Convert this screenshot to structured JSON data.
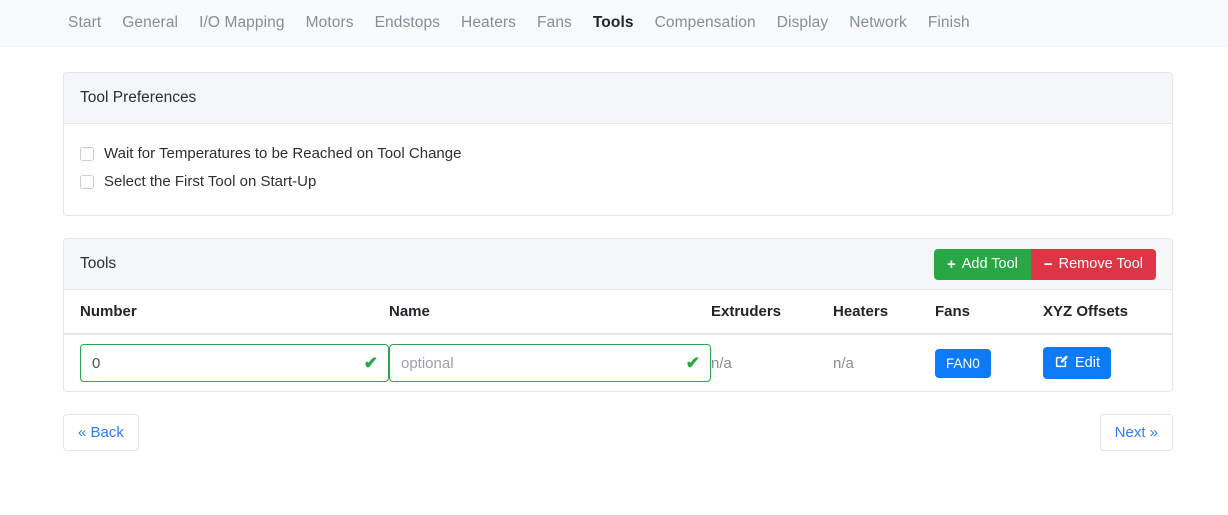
{
  "nav": {
    "items": [
      {
        "label": "Start",
        "active": false
      },
      {
        "label": "General",
        "active": false
      },
      {
        "label": "I/O Mapping",
        "active": false
      },
      {
        "label": "Motors",
        "active": false
      },
      {
        "label": "Endstops",
        "active": false
      },
      {
        "label": "Heaters",
        "active": false
      },
      {
        "label": "Fans",
        "active": false
      },
      {
        "label": "Tools",
        "active": true
      },
      {
        "label": "Compensation",
        "active": false
      },
      {
        "label": "Display",
        "active": false
      },
      {
        "label": "Network",
        "active": false
      },
      {
        "label": "Finish",
        "active": false
      }
    ]
  },
  "preferences": {
    "title": "Tool Preferences",
    "options": [
      {
        "label": "Wait for Temperatures to be Reached on Tool Change",
        "checked": false
      },
      {
        "label": "Select the First Tool on Start-Up",
        "checked": false
      }
    ]
  },
  "tools_panel": {
    "title": "Tools",
    "add_label": "Add Tool",
    "add_symbol": "+",
    "remove_label": "Remove Tool",
    "remove_symbol": "−",
    "columns": [
      "Number",
      "Name",
      "Extruders",
      "Heaters",
      "Fans",
      "XYZ Offsets"
    ],
    "rows": [
      {
        "number_value": "0",
        "number_placeholder": "",
        "number_valid": true,
        "name_value": "",
        "name_placeholder": "optional",
        "name_valid": true,
        "extruders": "n/a",
        "heaters": "n/a",
        "fans": "FAN0",
        "xyz_offsets_label": "Edit"
      }
    ],
    "valid_tick": "✔"
  },
  "footer": {
    "back_label": "« Back",
    "next_label": "Next »"
  },
  "colors": {
    "navbar_bg": "#f8f9fa",
    "success": "#28a745",
    "danger": "#dc3545",
    "primary": "#0d7bf7",
    "link": "#2f7cf6",
    "muted": "#868e96",
    "border": "#e4e6e8"
  }
}
